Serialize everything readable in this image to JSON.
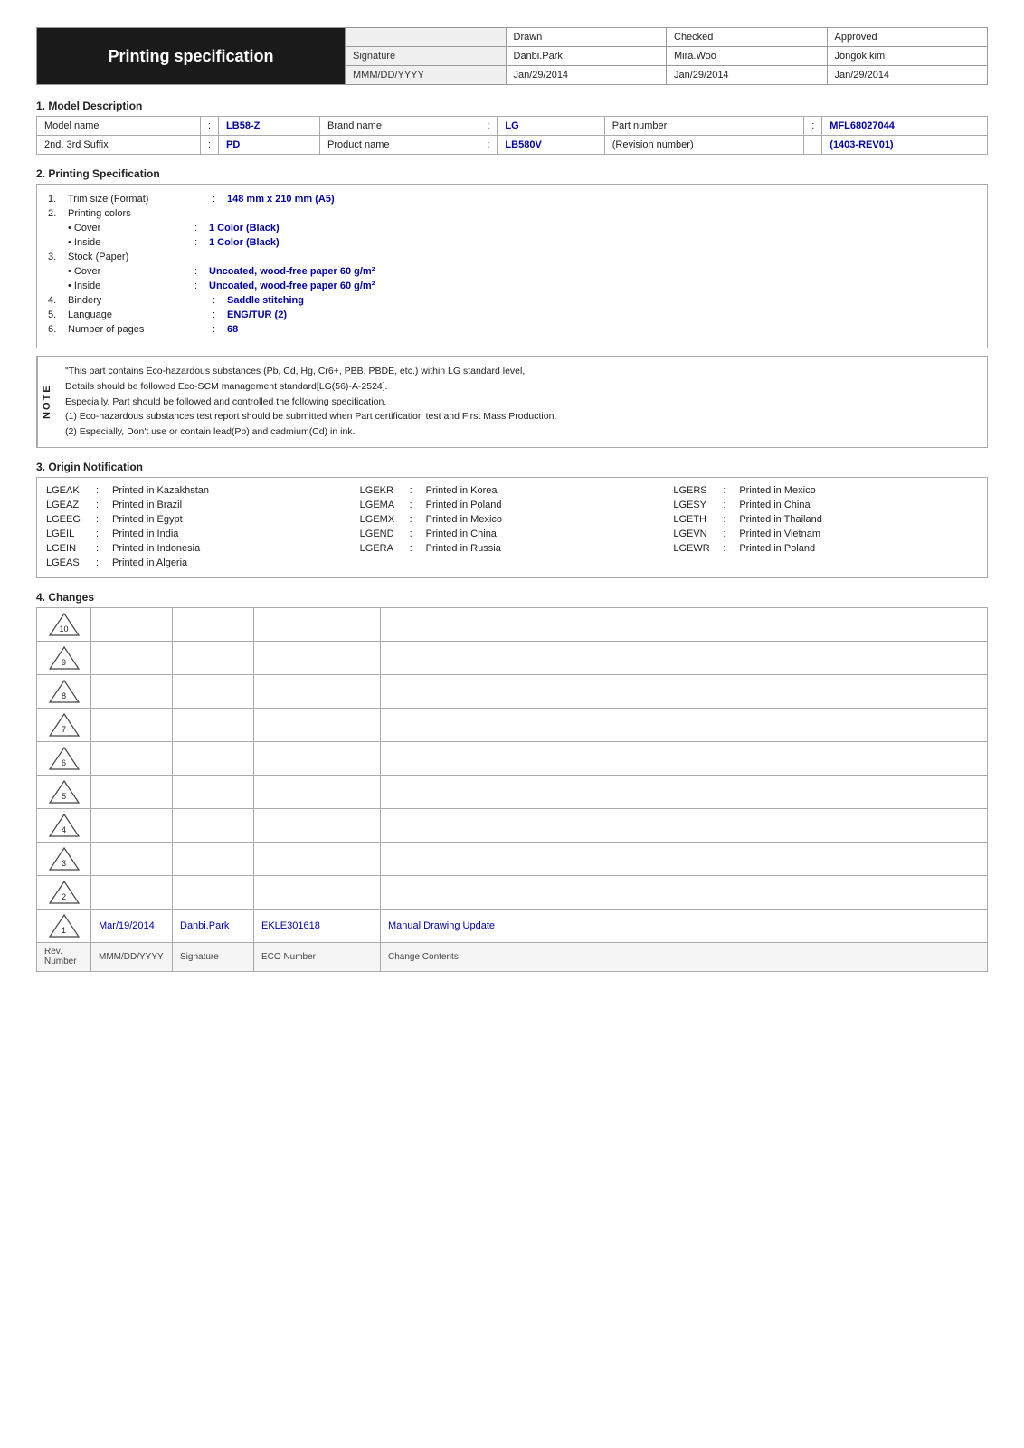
{
  "header": {
    "title": "Printing specification",
    "columns": [
      "",
      "Drawn",
      "Checked",
      "Approved"
    ],
    "rows": [
      {
        "label": "Signature",
        "drawn": "Danbi.Park",
        "checked": "Mira.Woo",
        "approved": "Jongok.kim"
      },
      {
        "label": "MMM/DD/YYYY",
        "drawn": "Jan/29/2014",
        "checked": "Jan/29/2014",
        "approved": "Jan/29/2014"
      }
    ]
  },
  "section1": {
    "title": "1. Model Description",
    "rows": [
      [
        {
          "label": "Model name",
          "colon": ":",
          "value": "LB58-Z"
        },
        {
          "label": "Brand name",
          "colon": ":",
          "value": "LG"
        },
        {
          "label": "Part number",
          "colon": ":",
          "value": "MFL68027044"
        }
      ],
      [
        {
          "label": "2nd, 3rd Suffix",
          "colon": ":",
          "value": "PD"
        },
        {
          "label": "Product name",
          "colon": ":",
          "value": "LB580V"
        },
        {
          "label": "(Revision number)",
          "colon": "",
          "value": "(1403-REV01)"
        }
      ]
    ]
  },
  "section2": {
    "title": "2. Printing Specification",
    "items": [
      {
        "num": "1.",
        "label": "Trim size (Format)",
        "colon": ":",
        "value": "148 mm x 210 mm (A5)",
        "indent": 0
      },
      {
        "num": "2.",
        "label": "Printing colors",
        "colon": "",
        "value": "",
        "indent": 0
      },
      {
        "num": "",
        "label": "• Cover",
        "colon": ":",
        "value": "1 Color (Black)",
        "indent": 1
      },
      {
        "num": "",
        "label": "• Inside",
        "colon": ":",
        "value": "1 Color (Black)",
        "indent": 1
      },
      {
        "num": "3.",
        "label": "Stock (Paper)",
        "colon": "",
        "value": "",
        "indent": 0
      },
      {
        "num": "",
        "label": "• Cover",
        "colon": ":",
        "value": "Uncoated, wood-free paper 60 g/m²",
        "indent": 1
      },
      {
        "num": "",
        "label": "• Inside",
        "colon": ":",
        "value": "Uncoated, wood-free paper 60 g/m²",
        "indent": 1
      },
      {
        "num": "4.",
        "label": "Bindery",
        "colon": ":",
        "value": "Saddle stitching",
        "indent": 0
      },
      {
        "num": "5.",
        "label": "Language",
        "colon": ":",
        "value": "ENG/TUR (2)",
        "indent": 0
      },
      {
        "num": "6.",
        "label": "Number of pages",
        "colon": ":",
        "value": "68",
        "indent": 0
      }
    ]
  },
  "note": {
    "side": "NOTE",
    "lines": [
      "\"This part contains Eco-hazardous substances (Pb, Cd, Hg, Cr6+, PBB, PBDE, etc.) within LG standard level,",
      "Details should be followed Eco-SCM management standard[LG(56)-A-2524].",
      "Especially, Part should be followed and controlled the following specification.",
      "(1) Eco-hazardous substances test report should be submitted when Part certification test and First Mass Production.",
      "(2) Especially, Don't use or contain lead(Pb) and cadmium(Cd) in ink."
    ]
  },
  "section3": {
    "title": "3. Origin Notification",
    "items": [
      {
        "code": "LGEAK",
        "desc": "Printed in Kazakhstan"
      },
      {
        "code": "LGEKR",
        "desc": "Printed in Korea"
      },
      {
        "code": "LGERS",
        "desc": "Printed in Mexico"
      },
      {
        "code": "LGEAZ",
        "desc": "Printed in Brazil"
      },
      {
        "code": "LGEMA",
        "desc": "Printed in Poland"
      },
      {
        "code": "LGESY",
        "desc": "Printed in China"
      },
      {
        "code": "LGEEG",
        "desc": "Printed in Egypt"
      },
      {
        "code": "LGEMX",
        "desc": "Printed in Mexico"
      },
      {
        "code": "LGETH",
        "desc": "Printed in Thailand"
      },
      {
        "code": "LGEIL",
        "desc": "Printed in India"
      },
      {
        "code": "LGEND",
        "desc": "Printed in China"
      },
      {
        "code": "LGEVN",
        "desc": "Printed in Vietnam"
      },
      {
        "code": "LGEIN",
        "desc": "Printed in Indonesia"
      },
      {
        "code": "LGERA",
        "desc": "Printed in Russia"
      },
      {
        "code": "LGEWR",
        "desc": "Printed in Poland"
      },
      {
        "code": "LGEAS",
        "desc": "Printed in Algeria"
      },
      {
        "code": "",
        "desc": ""
      },
      {
        "code": "",
        "desc": ""
      }
    ]
  },
  "section4": {
    "title": "4. Changes",
    "revisions": [
      {
        "rev": "10",
        "date": "",
        "signature": "",
        "eco": "",
        "content": ""
      },
      {
        "rev": "9",
        "date": "",
        "signature": "",
        "eco": "",
        "content": ""
      },
      {
        "rev": "8",
        "date": "",
        "signature": "",
        "eco": "",
        "content": ""
      },
      {
        "rev": "7",
        "date": "",
        "signature": "",
        "eco": "",
        "content": ""
      },
      {
        "rev": "6",
        "date": "",
        "signature": "",
        "eco": "",
        "content": ""
      },
      {
        "rev": "5",
        "date": "",
        "signature": "",
        "eco": "",
        "content": ""
      },
      {
        "rev": "4",
        "date": "",
        "signature": "",
        "eco": "",
        "content": ""
      },
      {
        "rev": "3",
        "date": "",
        "signature": "",
        "eco": "",
        "content": ""
      },
      {
        "rev": "2",
        "date": "",
        "signature": "",
        "eco": "",
        "content": ""
      },
      {
        "rev": "1",
        "date": "Mar/19/2014",
        "signature": "Danbi.Park",
        "eco": "EKLE301618",
        "content": "Manual Drawing Update"
      }
    ],
    "footer": {
      "rev_label": "Rev. Number",
      "date_label": "MMM/DD/YYYY",
      "sig_label": "Signature",
      "eco_label": "ECO Number",
      "content_label": "Change Contents"
    }
  }
}
